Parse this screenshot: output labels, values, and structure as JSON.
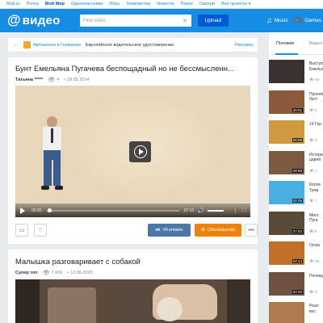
{
  "portal_nav": [
    {
      "label": "Mail.ru",
      "bold": false
    },
    {
      "label": "Почта",
      "bold": false
    },
    {
      "label": "Мой Мир",
      "bold": true
    },
    {
      "label": "Одноклассники",
      "bold": false
    },
    {
      "label": "Игры",
      "bold": false
    },
    {
      "label": "Знакомства",
      "bold": false
    },
    {
      "label": "Новости",
      "bold": false
    },
    {
      "label": "Поиск",
      "bold": false
    },
    {
      "label": "Смотри",
      "bold": false
    },
    {
      "label": "Все проекты ▾",
      "bold": false
    }
  ],
  "header": {
    "logo_at": "@",
    "logo_word": "видео",
    "search_placeholder": "Find video",
    "upload_label": "Upload",
    "music_label": "Music",
    "games_label": "Games",
    "colors": {
      "bar": "#168de2",
      "upload": "#005bd1"
    }
  },
  "ad": {
    "brand": "Автошкола в Германии",
    "text": "Европейское водительское удостоверение.",
    "label": "Реклама"
  },
  "videos": [
    {
      "title": "Бунт Емельяна Пугачева беспощадный но не бессмысленн...",
      "author": "Татьяна *****",
      "views": "4",
      "date": "29.05.2014",
      "time_current": "00:00",
      "time_total": "07:13",
      "progress": 0.01,
      "share_vk": "VKontakte",
      "share_ok": "Odnoklassniki"
    },
    {
      "title": "Малышка разговаривает с собакой",
      "author": "Супер топ",
      "views": "7 669",
      "date": "13.06.2020"
    }
  ],
  "sidebar": {
    "tabs": [
      "Похожие",
      "Видео"
    ],
    "items": [
      {
        "title": "Выступление Емельян",
        "views": "44",
        "duration": "",
        "thumb": "#3a3230"
      },
      {
        "title": "Пугачёвский бунт",
        "views": "3",
        "duration": "26:01",
        "thumb": "#8a5a3a"
      },
      {
        "title": "19 Гер",
        "views": "2",
        "duration": "06:58",
        "thumb": "#d09a40"
      },
      {
        "title": "История царей",
        "views": "1",
        "duration": "28:58",
        "thumb": "#7a5a40"
      },
      {
        "title": "Колле Тума",
        "views": "7",
        "duration": "02:05",
        "thumb": "#4aaee0"
      },
      {
        "title": "Мист Пуга",
        "views": "6",
        "duration": "27:02",
        "thumb": "#5a4a3a"
      },
      {
        "title": "Гроза",
        "views": "15",
        "duration": "04:14",
        "thumb": "#c0702a"
      },
      {
        "title": "Почему",
        "views": "2",
        "duration": "02:20",
        "thumb": "#705040"
      },
      {
        "title": "Реал вос",
        "views": "",
        "duration": "",
        "thumb": "#b07a50"
      }
    ]
  }
}
